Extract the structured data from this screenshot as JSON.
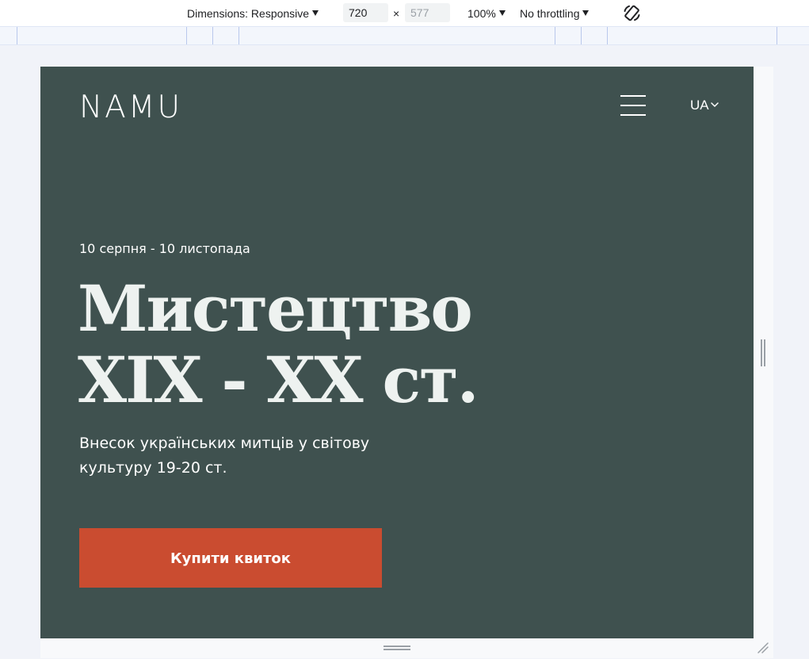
{
  "toolbar": {
    "dimensions_label": "Dimensions: Responsive",
    "width_value": "720",
    "height_placeholder": "577",
    "times_symbol": "×",
    "zoom_label": "100%",
    "throttling_label": "No throttling",
    "rotate_icon": "rotate-icon"
  },
  "site": {
    "logo": "NAMU",
    "menu_icon": "hamburger-menu-icon",
    "language": "UA",
    "dates": "10 серпня - 10 листопада",
    "headline_line1": "Мистецтво",
    "headline_line2": "XIX - XX ст.",
    "subtitle": "Внесок українських митців у світову культуру 19-20 ст.",
    "cta_label": "Купити квиток",
    "colors": {
      "background": "#3f514f",
      "accent": "#ca4c30",
      "text": "#ffffff"
    }
  }
}
